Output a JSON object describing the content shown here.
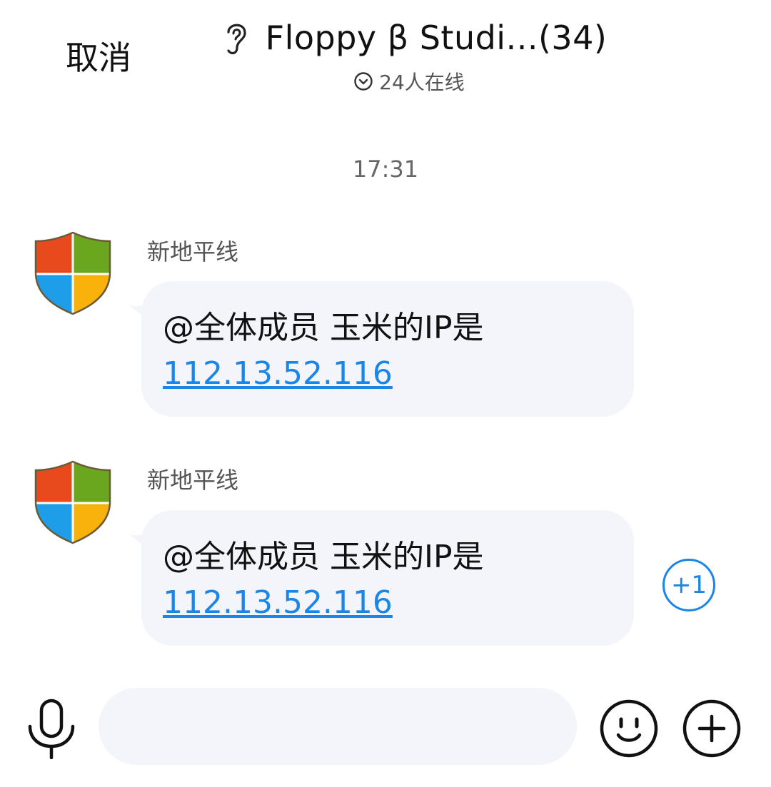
{
  "header": {
    "cancel_label": "取消",
    "title": "Floppy β Studi...(34)",
    "online": "24人在线",
    "ear_icon": "ear-icon",
    "chevron_icon": "chevron-down-circle-icon"
  },
  "timestamp": "17:31",
  "messages": [
    {
      "sender": "新地平线",
      "text": "@全体成员 玉米的IP是",
      "link": "112.13.52.116",
      "avatar_icon": "shield-avatar-icon"
    },
    {
      "sender": "新地平线",
      "text": "@全体成员 玉米的IP是",
      "link": "112.13.52.116",
      "avatar_icon": "shield-avatar-icon",
      "plus_one": "+1"
    }
  ],
  "input_bar": {
    "placeholder": "",
    "mic_icon": "microphone-icon",
    "emoji_icon": "smile-icon",
    "plus_icon": "plus-circle-icon"
  },
  "colors": {
    "link": "#1a86e8",
    "bubble_bg": "#f4f5fa",
    "shield_red": "#e8491d",
    "shield_green": "#6aa71f",
    "shield_blue": "#1e9ee8",
    "shield_yellow": "#f9b10b"
  }
}
